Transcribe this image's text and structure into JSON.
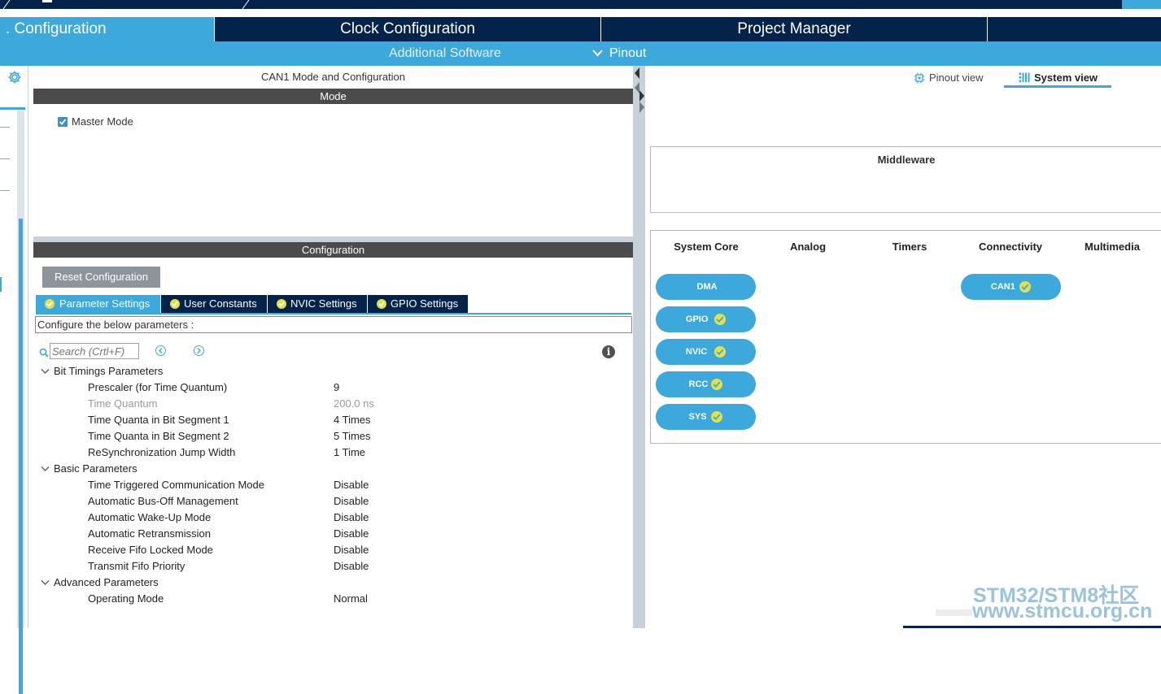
{
  "main_tabs": [
    {
      "label": ". Configuration",
      "active": true
    },
    {
      "label": "Clock Configuration",
      "active": false
    },
    {
      "label": "Project Manager",
      "active": false
    },
    {
      "label": "",
      "active": false
    }
  ],
  "sub_tabs": {
    "additional_software": "Additional Software",
    "pinout": "Pinout"
  },
  "mode_panel": {
    "title": "CAN1 Mode and Configuration",
    "mode_header": "Mode",
    "master_mode_label": "Master Mode",
    "master_mode_checked": true
  },
  "config_panel": {
    "header": "Configuration",
    "reset_button": "Reset Configuration",
    "tabs": [
      "Parameter Settings",
      "User Constants",
      "NVIC Settings",
      "GPIO Settings"
    ],
    "active_tab": "Parameter Settings",
    "description": "Configure the below parameters :",
    "search_placeholder": "Search (Crtl+F)",
    "groups": [
      {
        "name": "Bit Timings Parameters",
        "params": [
          {
            "name": "Prescaler (for Time Quantum)",
            "value": "9",
            "dim": false
          },
          {
            "name": "Time Quantum",
            "value": "200.0 ns",
            "dim": true
          },
          {
            "name": "Time Quanta in Bit Segment 1",
            "value": "4 Times",
            "dim": false
          },
          {
            "name": "Time Quanta in Bit Segment 2",
            "value": "5 Times",
            "dim": false
          },
          {
            "name": "ReSynchronization Jump Width",
            "value": "1 Time",
            "dim": false
          }
        ]
      },
      {
        "name": "Basic Parameters",
        "params": [
          {
            "name": "Time Triggered Communication Mode",
            "value": "Disable",
            "dim": false
          },
          {
            "name": "Automatic Bus-Off Management",
            "value": "Disable",
            "dim": false
          },
          {
            "name": "Automatic Wake-Up Mode",
            "value": "Disable",
            "dim": false
          },
          {
            "name": "Automatic Retransmission",
            "value": "Disable",
            "dim": false
          },
          {
            "name": "Receive Fifo Locked Mode",
            "value": "Disable",
            "dim": false
          },
          {
            "name": "Transmit Fifo Priority",
            "value": "Disable",
            "dim": false
          }
        ]
      },
      {
        "name": "Advanced Parameters",
        "params": [
          {
            "name": "Operating Mode",
            "value": "Normal",
            "dim": false
          }
        ]
      }
    ]
  },
  "right_panel": {
    "pinout_view": "Pinout view",
    "system_view": "System view",
    "middleware": "Middleware",
    "categories": [
      "System Core",
      "Analog",
      "Timers",
      "Connectivity",
      "Multimedia"
    ],
    "system_core_items": [
      {
        "label": "DMA",
        "ok": false
      },
      {
        "label": "GPIO",
        "ok": true
      },
      {
        "label": "NVIC",
        "ok": true
      },
      {
        "label": "RCC",
        "ok": true
      },
      {
        "label": "SYS",
        "ok": true
      }
    ],
    "connectivity_items": [
      {
        "label": "CAN1",
        "ok": true
      }
    ]
  },
  "watermark": {
    "line1": "STM32/STM8社区",
    "line2": "www.stmcu.org.cn"
  },
  "colors": {
    "navy": "#03234b",
    "accent_blue": "#3ca8dc",
    "dark_header": "#4b4b4b",
    "ok_yellow": "#e5e04a"
  }
}
